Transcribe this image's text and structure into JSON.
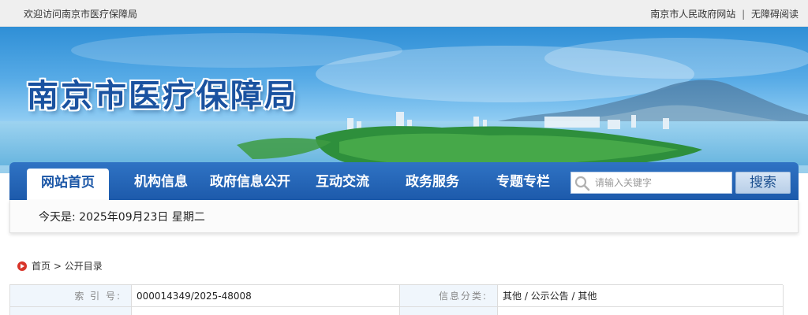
{
  "topbar": {
    "welcome": "欢迎访问南京市医疗保障局",
    "links": [
      "南京市人民政府网站",
      "无障碍阅读"
    ],
    "separator": "|"
  },
  "banner": {
    "site_title": "南京市医疗保障局"
  },
  "nav": {
    "items": [
      "网站首页",
      "机构信息",
      "政府信息公开",
      "互动交流",
      "政务服务",
      "专题专栏"
    ],
    "active_index": 0
  },
  "search": {
    "placeholder": "请输入关键字",
    "button_label": "搜索",
    "icon": "search-icon"
  },
  "date_line": "今天是: 2025年09月23日 星期二",
  "breadcrumb": {
    "home": "首页",
    "separator": ">",
    "current": "公开目录",
    "icon": "home-arrow-icon"
  },
  "meta": {
    "index_label": "索 引 号:",
    "index_value": "000014349/2025-48008",
    "category_label": "信息分类:",
    "category_value": "其他 / 公示公告 / 其他"
  },
  "colors": {
    "nav_blue": "#1d5aab",
    "title_blue": "#1a52a0",
    "home_icon_red": "#d8352a"
  }
}
